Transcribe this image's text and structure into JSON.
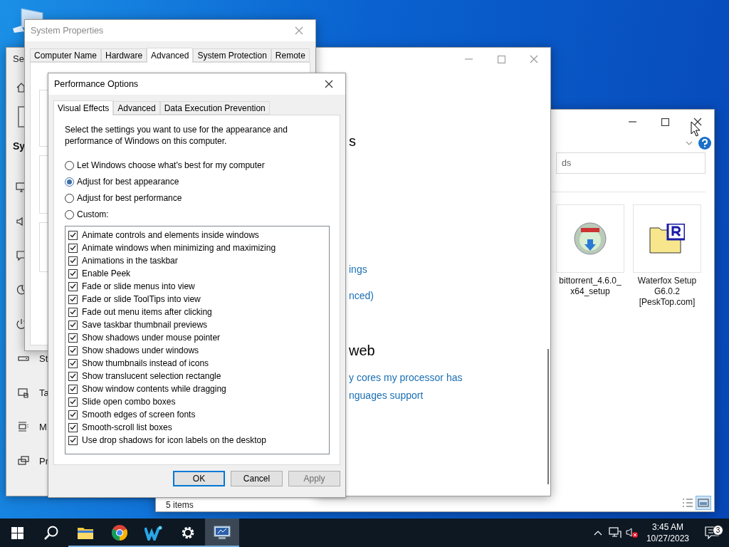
{
  "settings_window": {
    "title_fragment": "Se",
    "section_fragment": "Sy",
    "nav_items": [
      {
        "label": "St"
      },
      {
        "label": "Ta"
      },
      {
        "label": "M"
      },
      {
        "label": "Pr"
      }
    ]
  },
  "explorer": {
    "search": {
      "value": "ds"
    },
    "files": [
      {
        "kind": "installer",
        "label_lines": [
          "bittorrent_4.6.0_",
          "x64_setup"
        ]
      },
      {
        "kind": "archive",
        "label_lines": [
          "Waterfox Setup",
          "G6.0.2",
          "[PeskTop.com]"
        ]
      }
    ],
    "status": "5 items"
  },
  "system_window": {
    "sections": [
      {
        "heading": "s",
        "links": [
          "ings",
          "nced)"
        ]
      },
      {
        "heading": "web",
        "links": [
          "y cores my processor has",
          "nguages support"
        ]
      }
    ]
  },
  "system_properties": {
    "title": "System Properties",
    "tabs": [
      {
        "label": "Computer Name",
        "selected": false
      },
      {
        "label": "Hardware",
        "selected": false
      },
      {
        "label": "Advanced",
        "selected": true
      },
      {
        "label": "System Protection",
        "selected": false
      },
      {
        "label": "Remote",
        "selected": false
      }
    ]
  },
  "performance_options": {
    "title": "Performance Options",
    "tabs": [
      {
        "label": "Visual Effects",
        "selected": true
      },
      {
        "label": "Advanced",
        "selected": false
      },
      {
        "label": "Data Execution Prevention",
        "selected": false
      }
    ],
    "intro": "Select the settings you want to use for the appearance and performance of Windows on this computer.",
    "options": [
      {
        "label": "Let Windows choose what's best for my computer",
        "selected": false
      },
      {
        "label": "Adjust for best appearance",
        "selected": true
      },
      {
        "label": "Adjust for best performance",
        "selected": false
      },
      {
        "label": "Custom:",
        "selected": false
      }
    ],
    "effects": [
      {
        "label": "Animate controls and elements inside windows",
        "checked": true
      },
      {
        "label": "Animate windows when minimizing and maximizing",
        "checked": true
      },
      {
        "label": "Animations in the taskbar",
        "checked": true
      },
      {
        "label": "Enable Peek",
        "checked": true
      },
      {
        "label": "Fade or slide menus into view",
        "checked": true
      },
      {
        "label": "Fade or slide ToolTips into view",
        "checked": true
      },
      {
        "label": "Fade out menu items after clicking",
        "checked": true
      },
      {
        "label": "Save taskbar thumbnail previews",
        "checked": true
      },
      {
        "label": "Show shadows under mouse pointer",
        "checked": true
      },
      {
        "label": "Show shadows under windows",
        "checked": true
      },
      {
        "label": "Show thumbnails instead of icons",
        "checked": true
      },
      {
        "label": "Show translucent selection rectangle",
        "checked": true
      },
      {
        "label": "Show window contents while dragging",
        "checked": true
      },
      {
        "label": "Slide open combo boxes",
        "checked": true
      },
      {
        "label": "Smooth edges of screen fonts",
        "checked": true
      },
      {
        "label": "Smooth-scroll list boxes",
        "checked": true
      },
      {
        "label": "Use drop shadows for icon labels on the desktop",
        "checked": true
      }
    ],
    "buttons": [
      {
        "label": "OK",
        "default": true,
        "disabled": false
      },
      {
        "label": "Cancel",
        "default": false,
        "disabled": false
      },
      {
        "label": "Apply",
        "default": false,
        "disabled": true
      }
    ]
  },
  "taskbar": {
    "apps": [
      {
        "kind": "explorer",
        "running": true,
        "active": false
      },
      {
        "kind": "chrome",
        "running": true,
        "active": false
      },
      {
        "kind": "writer",
        "running": true,
        "active": false
      },
      {
        "kind": "settings",
        "running": true,
        "active": false
      },
      {
        "kind": "system",
        "running": true,
        "active": true
      }
    ],
    "time": "3:45 AM",
    "date": "10/27/2023",
    "notification_count": "3"
  }
}
